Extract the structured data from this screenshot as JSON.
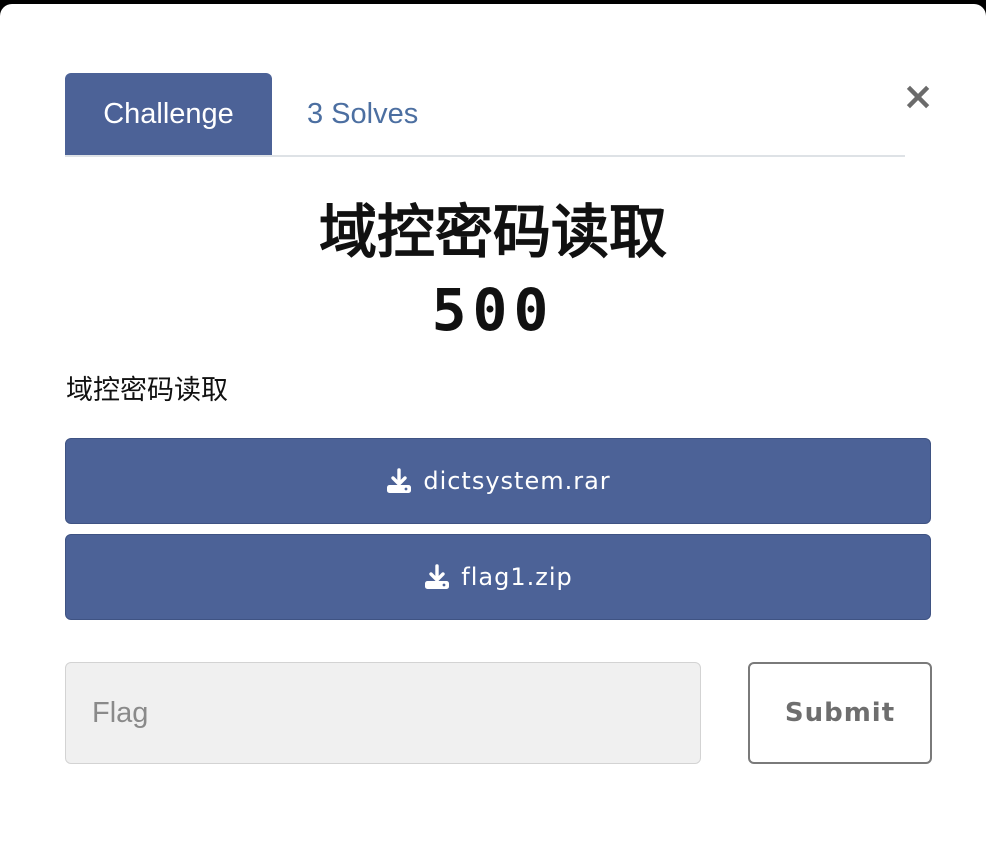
{
  "tabs": [
    {
      "label": "Challenge",
      "active": true
    },
    {
      "label": "3 Solves",
      "active": false
    }
  ],
  "close_symbol": "×",
  "challenge": {
    "title": "域控密码读取",
    "value": "500",
    "description": "域控密码读取"
  },
  "files": [
    {
      "name": "dictsystem.rar",
      "icon": "download-icon"
    },
    {
      "name": "flag1.zip",
      "icon": "download-icon"
    }
  ],
  "flag_input": {
    "placeholder": "Flag",
    "value": ""
  },
  "submit_label": "Submit",
  "colors": {
    "accent": "#4c6297",
    "tab_link": "#4c6fa1",
    "input_bg": "#f0f0f0",
    "backdrop": "#000000"
  }
}
